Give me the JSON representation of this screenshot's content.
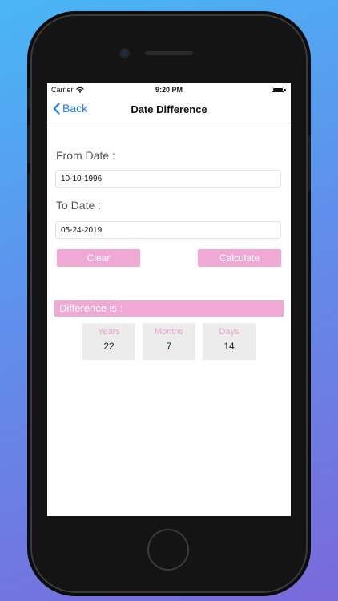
{
  "status_bar": {
    "carrier": "Carrier",
    "time": "9:20 PM"
  },
  "nav": {
    "back_label": "Back",
    "title": "Date Difference"
  },
  "form": {
    "from_label": "From Date :",
    "from_value": "10-10-1996",
    "to_label": "To Date :",
    "to_value": "05-24-2019",
    "clear_label": "Clear",
    "calculate_label": "Calculate"
  },
  "result": {
    "header": "Difference is :",
    "years_label": "Years",
    "years_value": "22",
    "months_label": "Months",
    "months_value": "7",
    "days_label": "Days",
    "days_value": "14"
  },
  "colors": {
    "accent_pink": "#f0a9d4",
    "ios_blue": "#1f7cf2"
  },
  "icons": {
    "wifi": "wifi-icon",
    "battery": "battery-icon",
    "back": "chevron-left-icon"
  }
}
